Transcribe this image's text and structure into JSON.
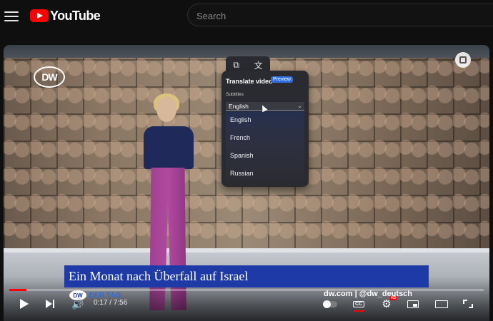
{
  "header": {
    "logo_text": "YouTube",
    "search_placeholder": "Search"
  },
  "video": {
    "channel_logo": "DW",
    "headline": "Ein Monat nach Überfall auf Israel",
    "program_tag_logo": "DW",
    "program_tag": "DER TAG",
    "handle": "dw.com | @dw_deutsch"
  },
  "translate_popup": {
    "title": "Translate video",
    "badge": "Preview",
    "subtitles_label": "Subtitles",
    "selected": "English",
    "options": [
      "English",
      "French",
      "Spanish",
      "Russian"
    ]
  },
  "player": {
    "current_time": "0:17",
    "duration": "7:56",
    "time_display": "0:17 / 7:56",
    "progress_fraction": 0.036,
    "hd_badge": "HD",
    "accent_color": "#ff0000"
  }
}
